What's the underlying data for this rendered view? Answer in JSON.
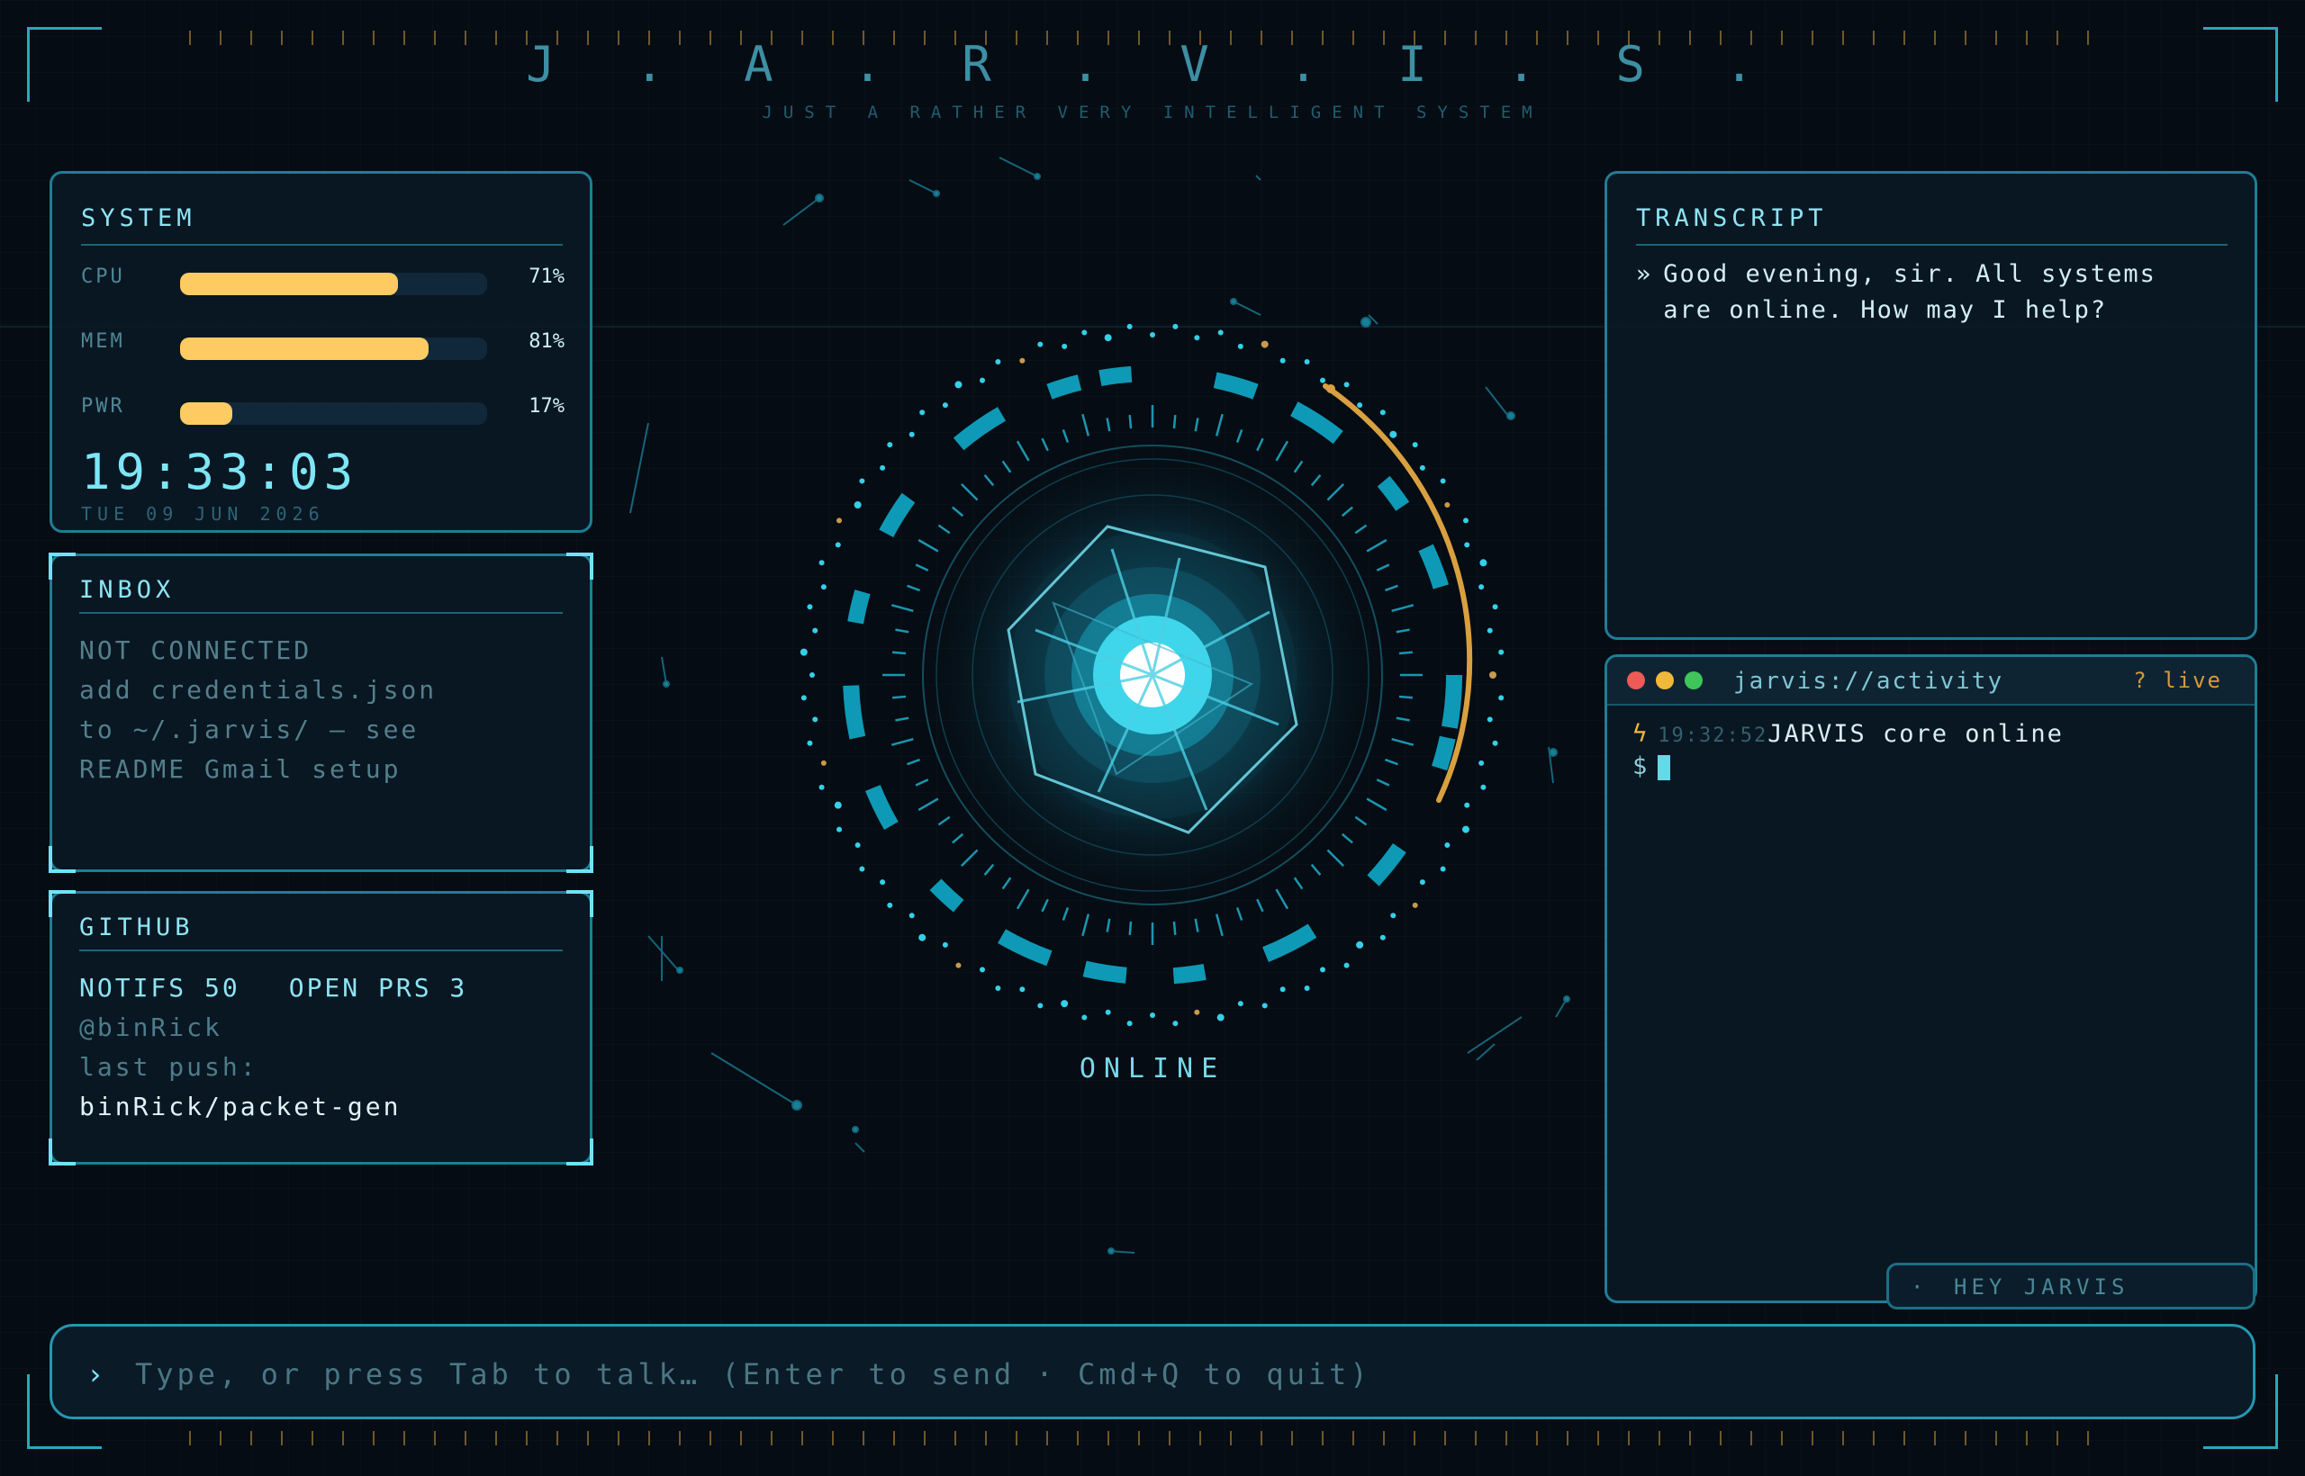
{
  "header": {
    "title": "J . A . R . V . I . S .",
    "subtitle": "JUST A RATHER VERY INTELLIGENT SYSTEM"
  },
  "system": {
    "title": "SYSTEM",
    "meters": [
      {
        "label": "CPU",
        "value_text": "71%",
        "percent": 71
      },
      {
        "label": "MEM",
        "value_text": "81%",
        "percent": 81
      },
      {
        "label": "PWR",
        "value_text": "17%",
        "percent": 17
      }
    ],
    "clock": "19:33:03",
    "date": "TUE 09 JUN 2026"
  },
  "inbox": {
    "title": "INBOX",
    "lines": [
      "NOT CONNECTED",
      "add credentials.json",
      "to ~/.jarvis/ — see",
      "README Gmail setup"
    ]
  },
  "github": {
    "title": "GITHUB",
    "notifs": "NOTIFS 50",
    "open_prs": "OPEN PRS 3",
    "handle": "@binRick",
    "last_push_label": "last push:",
    "last_push_repo": "binRick/packet-gen"
  },
  "transcript": {
    "title": "TRANSCRIPT",
    "prompt": "»",
    "message": "Good evening, sir. All systems are online. How may I help?"
  },
  "activity": {
    "title": "jarvis://activity",
    "live": "? live",
    "entries": [
      {
        "icon": "bolt-icon",
        "time": "19:32:52",
        "text": "JARVIS core online"
      }
    ],
    "prompt": "$"
  },
  "core": {
    "status": "ONLINE"
  },
  "hey_button": {
    "dot": "·",
    "label": "HEY JARVIS"
  },
  "input": {
    "chevron": "›",
    "placeholder": "Type, or press Tab to talk…  (Enter to send · Cmd+Q to quit)"
  },
  "colors": {
    "accent_cyan": "#6ee3f6",
    "meter_fill": "#fecb62",
    "frame": "#1f7d95",
    "arc_orange": "#d9a040",
    "background": "#060c13"
  }
}
